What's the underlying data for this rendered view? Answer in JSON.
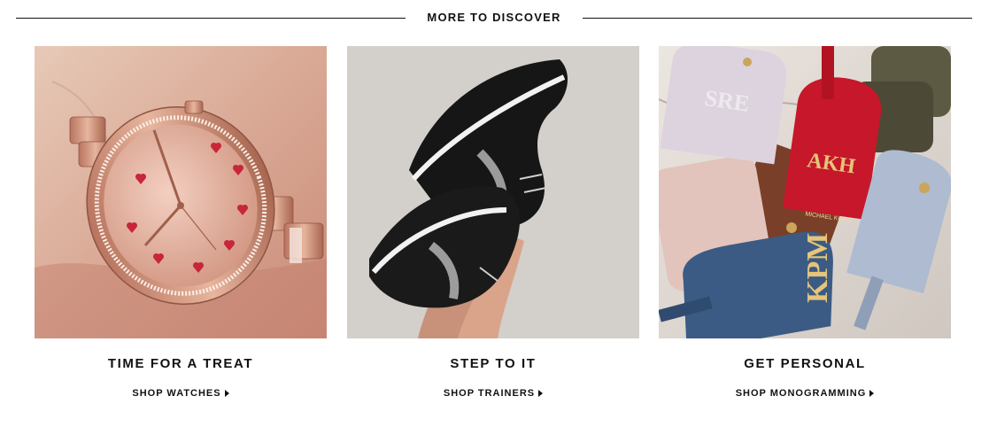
{
  "section": {
    "title": "MORE TO DISCOVER"
  },
  "cards": [
    {
      "image_subject": "rose-gold watch with heart markers",
      "title": "TIME FOR A TREAT",
      "link": "SHOP WATCHES",
      "icon": "caret-right-icon"
    },
    {
      "image_subject": "legs in black trainers",
      "title": "STEP TO IT",
      "link": "SHOP TRAINERS",
      "icon": "caret-right-icon"
    },
    {
      "image_subject": "monogrammed luggage tags",
      "title": "GET PERSONAL",
      "link": "SHOP MONOGRAMMING",
      "icon": "caret-right-icon",
      "tag_monograms": [
        "SRE",
        "AKH",
        "KPM"
      ],
      "tag_brand": "MICHAEL KORS"
    }
  ],
  "colors": {
    "text": "#111111",
    "background": "#ffffff",
    "rule": "#111111"
  }
}
